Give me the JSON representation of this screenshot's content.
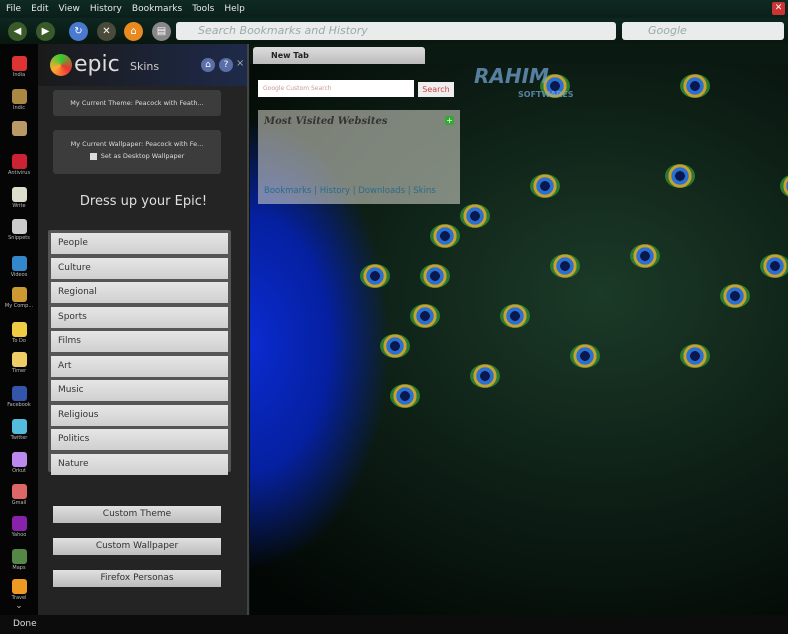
{
  "menu": [
    "File",
    "Edit",
    "View",
    "History",
    "Bookmarks",
    "Tools",
    "Help"
  ],
  "toolbar": {
    "url_placeholder": "Search Bookmarks and History",
    "search_placeholder": "Google"
  },
  "sidebar": [
    "India",
    "Indic",
    "",
    "Antivirus",
    "Write",
    "Snippets",
    "Videos",
    "My Comp...",
    "To Do",
    "Timer",
    "Facebook",
    "Twitter",
    "Orkut",
    "Gmail",
    "Yahoo",
    "Maps",
    "Travel"
  ],
  "panel": {
    "logo": "epic",
    "title": "Skins",
    "current_theme": "My Current Theme: Peacock with Feath...",
    "current_wallpaper": "My Current Wallpaper: Peacock with Fe...",
    "set_desktop": "Set as Desktop Wallpaper",
    "heading": "Dress up your Epic!",
    "categories": [
      "People",
      "Culture",
      "Regional",
      "Sports",
      "Films",
      "Art",
      "Music",
      "Religious",
      "Politics",
      "Nature"
    ],
    "buttons": [
      "Custom Theme",
      "Custom Wallpaper",
      "Firefox Personas"
    ]
  },
  "tab": {
    "label": "New Tab"
  },
  "newtab": {
    "search_placeholder": "Google Custom Search",
    "search_button": "Search",
    "most_visited": "Most Visited Websites",
    "links": [
      "Bookmarks",
      "History",
      "Downloads",
      "Skins"
    ],
    "brand": "RAHIM",
    "brand_sub": "SOFTWARES"
  },
  "status": "Done",
  "colors": {
    "accent": "#3a6fd0",
    "panel": "#242424"
  }
}
